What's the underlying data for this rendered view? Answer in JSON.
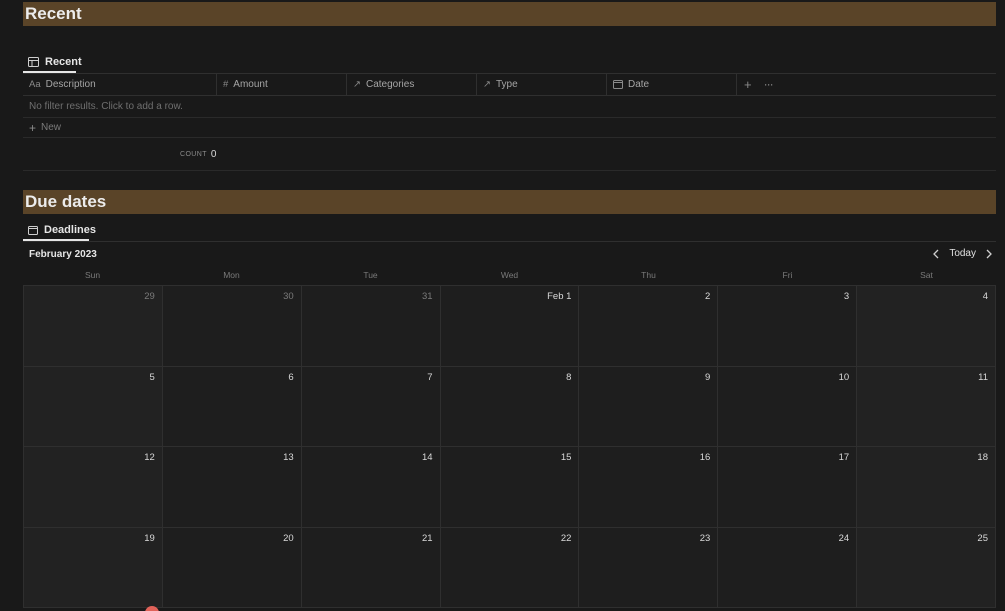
{
  "sections": {
    "recent": {
      "title": "Recent",
      "view_tab": "Recent",
      "columns": [
        {
          "icon": "text-icon",
          "glyph": "Aa",
          "label": "Description"
        },
        {
          "icon": "number-icon",
          "glyph": "#",
          "label": "Amount"
        },
        {
          "icon": "relation-icon",
          "glyph": "↗",
          "label": "Categories"
        },
        {
          "icon": "relation-icon",
          "glyph": "↗",
          "label": "Type"
        },
        {
          "icon": "date-icon",
          "glyph": "▭",
          "label": "Date"
        }
      ],
      "empty_message": "No filter results. Click to add a row.",
      "new_label": "New",
      "count_label": "COUNT",
      "count_value": "0"
    },
    "due": {
      "title": "Due dates",
      "view_tab": "Deadlines",
      "month": "February 2023",
      "today_label": "Today",
      "weekdays": [
        "Sun",
        "Mon",
        "Tue",
        "Wed",
        "Thu",
        "Fri",
        "Sat"
      ],
      "days": [
        "29",
        "30",
        "31",
        "Feb 1",
        "2",
        "3",
        "4",
        "5",
        "6",
        "7",
        "8",
        "9",
        "10",
        "11",
        "12",
        "13",
        "14",
        "15",
        "16",
        "17",
        "18",
        "19",
        "20",
        "21",
        "22",
        "23",
        "24",
        "25"
      ]
    }
  },
  "colors": {
    "heading_bg": "#5a4428",
    "page_bg": "#191919",
    "today_marker": "#e16259"
  }
}
